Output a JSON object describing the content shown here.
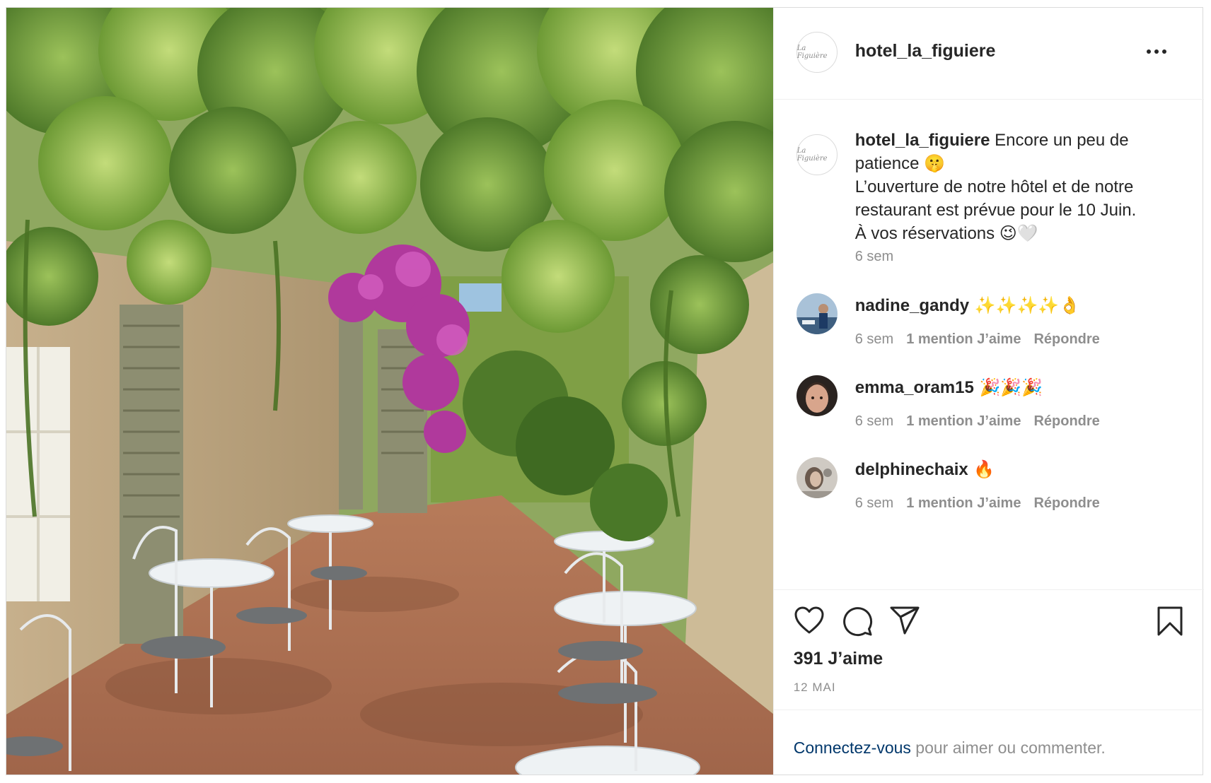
{
  "post": {
    "image_alt": "Terrasse ombragée sous une treille avec tables de bistrot blanches",
    "account": "hotel_la_figuiere",
    "avatar_text": "La Figuière",
    "caption": {
      "username": "hotel_la_figuiere",
      "line1": " Encore un peu de patience 🤫",
      "line2": "L’ouverture de notre hôtel et de notre restaurant est prévue pour le 10 Juin.",
      "line3": "À vos réservations 😉🤍",
      "time": "6 sem"
    },
    "comments": [
      {
        "username": "nadine_gandy",
        "text": " ✨✨✨✨👌",
        "time": "6 sem",
        "likes": "1 mention J’aime",
        "reply": "Répondre"
      },
      {
        "username": "emma_oram15",
        "text": " 🎉🎉🎉",
        "time": "6 sem",
        "likes": "1 mention J’aime",
        "reply": "Répondre"
      },
      {
        "username": "delphinechaix",
        "text": " 🔥",
        "time": "6 sem",
        "likes": "1 mention J’aime",
        "reply": "Répondre"
      }
    ],
    "likes": "391 J’aime",
    "date": "12 MAI",
    "login_link": "Connectez-vous",
    "login_rest": " pour aimer ou commenter."
  },
  "icons": [
    "heart-icon",
    "comment-icon",
    "share-icon",
    "bookmark-icon",
    "more-icon"
  ]
}
